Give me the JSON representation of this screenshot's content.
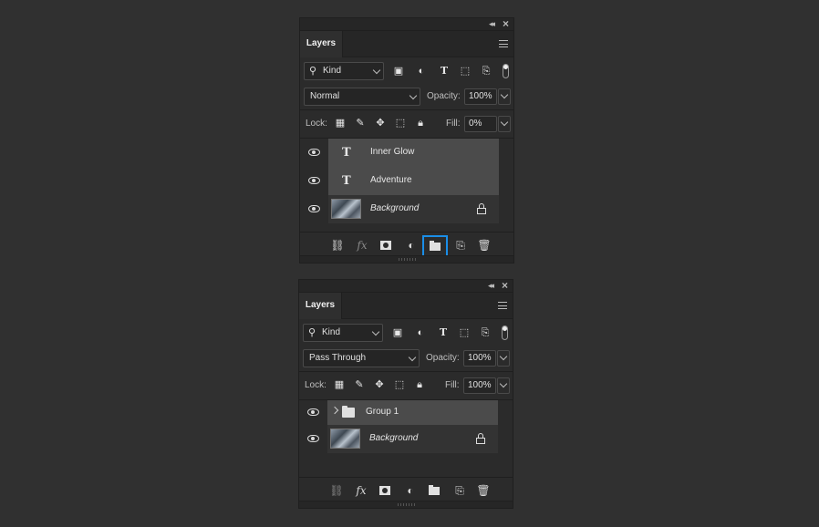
{
  "panel1": {
    "title": "Layers",
    "filter": {
      "label": "Kind"
    },
    "blend_mode": "Normal",
    "opacity_label": "Opacity:",
    "opacity_value": "100%",
    "lock_label": "Lock:",
    "fill_label": "Fill:",
    "fill_value": "0%",
    "layers": [
      {
        "name": "Inner Glow",
        "type": "text",
        "selected": true
      },
      {
        "name": "Adventure",
        "type": "text",
        "selected": true
      },
      {
        "name": "Background",
        "type": "image",
        "locked": true,
        "italic": true
      }
    ],
    "footer_highlighted": "new-group-button"
  },
  "panel2": {
    "title": "Layers",
    "filter": {
      "label": "Kind"
    },
    "blend_mode": "Pass Through",
    "opacity_label": "Opacity:",
    "opacity_value": "100%",
    "lock_label": "Lock:",
    "fill_label": "Fill:",
    "fill_value": "100%",
    "layers": [
      {
        "name": "Group 1",
        "type": "group",
        "selected": true,
        "collapsed": true
      },
      {
        "name": "Background",
        "type": "image",
        "locked": true,
        "italic": true
      }
    ]
  },
  "icons": {
    "fx": "fx",
    "text_filter": "T"
  },
  "colors": {
    "highlight": "#1a8ee8",
    "background": "#303030",
    "panel": "#2b2b2b",
    "selected_layer": "#4b4b4b"
  }
}
